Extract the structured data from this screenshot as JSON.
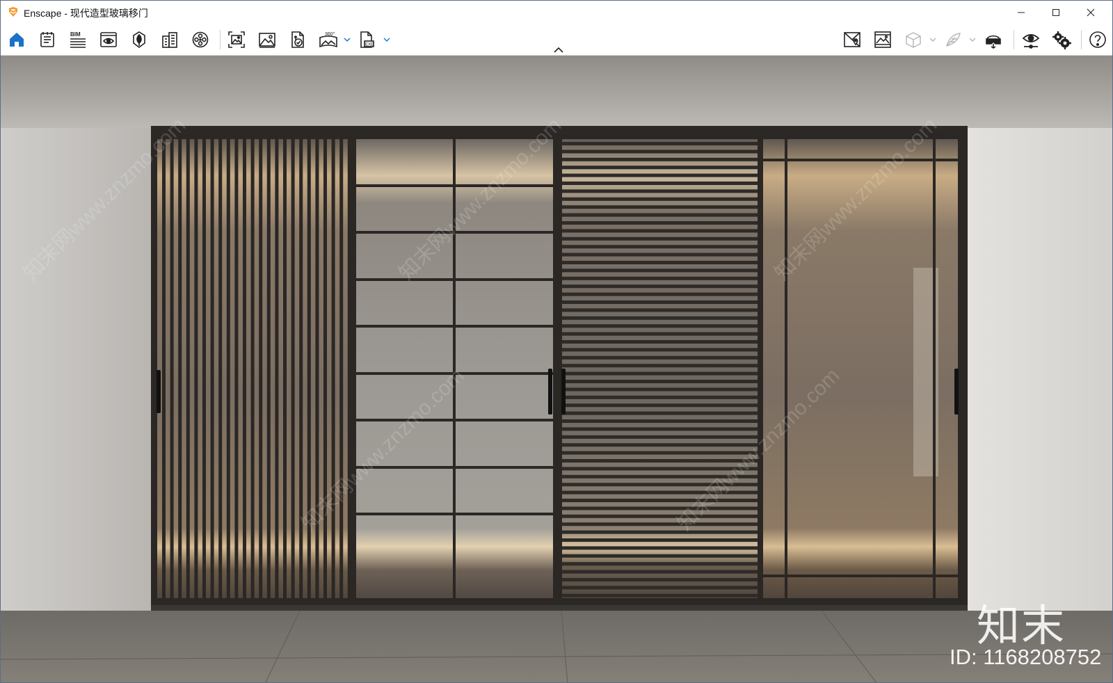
{
  "window": {
    "app_name": "Enscape",
    "title": "Enscape - 现代造型玻璃移门",
    "controls": [
      "minimize",
      "maximize",
      "close"
    ]
  },
  "toolbar": {
    "left_buttons": [
      {
        "name": "home",
        "icon": "home-icon",
        "active": true
      },
      {
        "name": "views",
        "icon": "notes-icon"
      },
      {
        "name": "bim",
        "icon": "bim-icon",
        "label": "BIM"
      },
      {
        "name": "view-management",
        "icon": "eye-window-icon"
      },
      {
        "name": "asset-library",
        "icon": "tree-icon"
      },
      {
        "name": "bim-mode",
        "icon": "building-icon"
      },
      {
        "name": "video-editor",
        "icon": "film-reel-icon"
      },
      {
        "name": "screenshot",
        "icon": "capture-frame-icon"
      },
      {
        "name": "batch-rendering",
        "icon": "image-icon"
      },
      {
        "name": "upload",
        "icon": "file-check-icon"
      },
      {
        "name": "panorama",
        "icon": "panorama-icon",
        "label": "360°"
      },
      {
        "name": "export",
        "icon": "export-file-icon",
        "label": "EXE"
      }
    ],
    "right_buttons": [
      {
        "name": "material-editor",
        "icon": "map-pin-icon"
      },
      {
        "name": "image-export",
        "icon": "image-frame-icon"
      },
      {
        "name": "orthographic",
        "icon": "cube-icon",
        "disabled": true
      },
      {
        "name": "feather",
        "icon": "feather-icon",
        "disabled": true
      },
      {
        "name": "vr-headset",
        "icon": "vr-headset-icon"
      },
      {
        "name": "visual-settings",
        "icon": "eye-slider-icon"
      },
      {
        "name": "general-settings",
        "icon": "gears-icon"
      },
      {
        "name": "help",
        "icon": "help-icon"
      }
    ]
  },
  "viewport": {
    "watermark_brand": "知末",
    "watermark_id": "ID: 1168208752",
    "watermark_diagonal": "知末网www.znzmo.com"
  },
  "colors": {
    "accent_blue": "#1a73c8",
    "wall": "#d9d7d4",
    "ceiling": "#bfbcb8",
    "floor": "#77736e",
    "frame": "#2a2725",
    "glass": "#6f6862",
    "warm_light": "#f2dcb6"
  }
}
